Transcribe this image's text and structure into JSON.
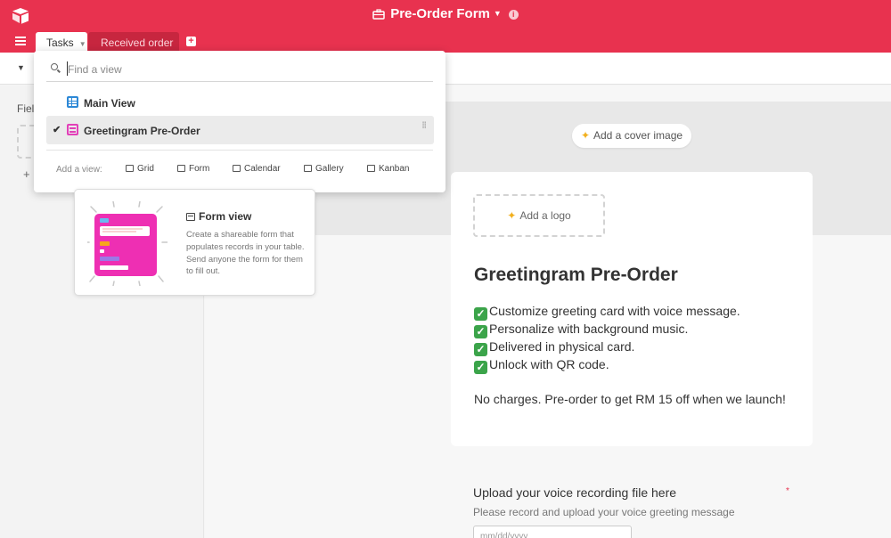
{
  "header": {
    "base_title": "Pre-Order Form",
    "brand_color": "#e8324f",
    "title_icon": "briefcase-icon"
  },
  "tabs": [
    {
      "label": "Tasks",
      "active": true
    },
    {
      "label": "Received order",
      "active": false
    }
  ],
  "left_panel": {
    "fields_label": "Fiel",
    "add_symbol": "+"
  },
  "view_menu": {
    "search_placeholder": "Find a view",
    "views": [
      {
        "label": "Main View",
        "icon": "grid-icon",
        "selected": false
      },
      {
        "label": "Greetingram Pre-Order",
        "icon": "form-icon",
        "selected": true
      }
    ],
    "add_view_label": "Add a view:",
    "add_options": [
      "Grid",
      "Form",
      "Calendar",
      "Gallery",
      "Kanban"
    ]
  },
  "tooltip": {
    "title": "Form view",
    "body": "Create a shareable form that populates records in your table. Send anyone the form for them to fill out."
  },
  "form": {
    "cover_button": "Add a cover image",
    "logo_button": "Add a logo",
    "title": "Greetingram Pre-Order",
    "checklist": [
      "Customize greeting card with voice message.",
      "Personalize with background music.",
      "Delivered in physical card.",
      "Unlock with QR code."
    ],
    "note": "No charges. Pre-order to get RM 15 off when we launch!",
    "question": {
      "label": "Upload your voice recording file here",
      "required_mark": "*",
      "help": "Please record and upload your voice greeting message",
      "input_placeholder": "mm/dd/yyyy"
    }
  }
}
